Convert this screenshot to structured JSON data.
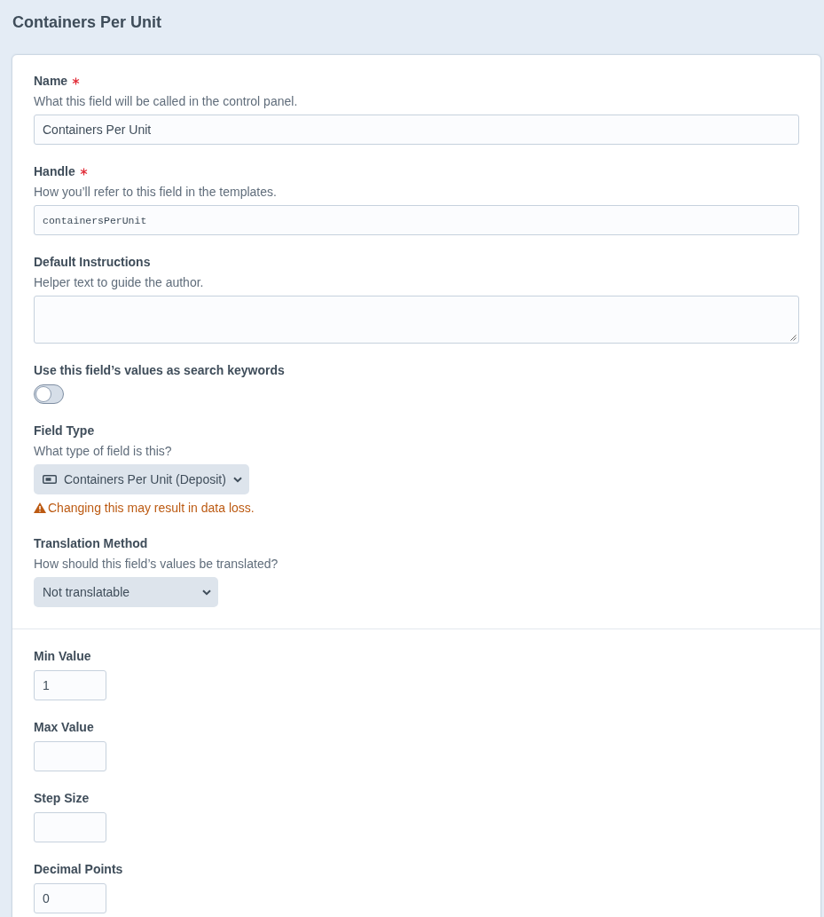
{
  "title": "Containers Per Unit",
  "fields": [
    {
      "kind": "text",
      "label": "Name",
      "required": true,
      "instructions": "What this field will be called in the control panel.",
      "value": "Containers Per Unit"
    },
    {
      "kind": "code",
      "label": "Handle",
      "required": true,
      "instructions": "How you’ll refer to this field in the templates.",
      "value": "containersPerUnit"
    },
    {
      "kind": "textarea",
      "label": "Default Instructions",
      "required": false,
      "instructions": "Helper text to guide the author."
    },
    {
      "kind": "toggle",
      "label": "Use this field’s values as search keywords",
      "required": false,
      "on": false
    },
    {
      "kind": "icon-select",
      "label": "Field Type",
      "required": false,
      "instructions": "What type of field is this?",
      "value": "Containers Per Unit (Deposit)",
      "warning": "Changing this may result in data loss."
    },
    {
      "kind": "select",
      "label": "Translation Method",
      "required": false,
      "instructions": "How should this field’s values be translated?",
      "value": "Not translatable"
    }
  ],
  "settings": [
    {
      "kind": "number",
      "label": "Min Value",
      "value": "1"
    },
    {
      "kind": "number",
      "label": "Max Value"
    },
    {
      "kind": "number",
      "label": "Step Size"
    },
    {
      "kind": "number",
      "label": "Decimal Points",
      "value": "0"
    }
  ]
}
